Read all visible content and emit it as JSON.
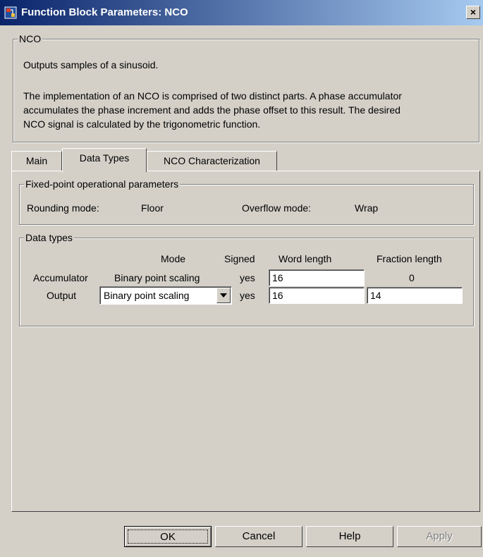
{
  "window": {
    "title": "Function Block Parameters: NCO",
    "close_label": "×"
  },
  "description": {
    "group_label": "NCO",
    "line1": "Outputs samples of a sinusoid.",
    "line2": "The implementation of an NCO is comprised of two distinct parts. A phase accumulator",
    "line3": "accumulates the phase increment and adds the phase offset to this result. The desired",
    "line4": "NCO signal is calculated by the trigonometric function."
  },
  "tabs": [
    {
      "label": "Main",
      "active": false
    },
    {
      "label": "Data Types",
      "active": true
    },
    {
      "label": "NCO Characterization",
      "active": false
    }
  ],
  "fixed_point": {
    "group_label": "Fixed-point operational parameters",
    "rounding_label": "Rounding mode:",
    "rounding_value": "Floor",
    "overflow_label": "Overflow mode:",
    "overflow_value": "Wrap"
  },
  "data_types": {
    "group_label": "Data types",
    "headers": {
      "mode": "Mode",
      "signed": "Signed",
      "word_length": "Word length",
      "fraction_length": "Fraction length"
    },
    "accumulator": {
      "label": "Accumulator",
      "mode": "Binary point scaling",
      "signed": "yes",
      "word_length": "16",
      "fraction_length": "0"
    },
    "output": {
      "label": "Output",
      "mode": "Binary point scaling",
      "signed": "yes",
      "word_length": "16",
      "fraction_length": "14"
    }
  },
  "buttons": {
    "ok": "OK",
    "cancel": "Cancel",
    "help": "Help",
    "apply": "Apply"
  },
  "colors": {
    "titlebar_start": "#0a246a",
    "titlebar_end": "#a6caf0",
    "face": "#d4d0c8"
  }
}
